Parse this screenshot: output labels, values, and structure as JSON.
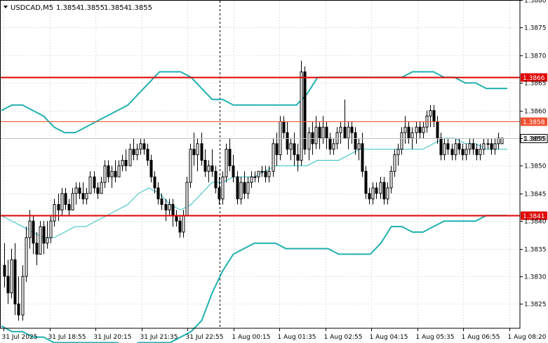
{
  "header": {
    "symbol_label": "USDCAD,M5",
    "ohlc": [
      "1.3854",
      "1.3855",
      "1.3854",
      "1.3855"
    ]
  },
  "chart_data": {
    "type": "candlestick",
    "symbol": "USDCAD",
    "timeframe": "M5",
    "ylim": [
      1.38206,
      1.388
    ],
    "y_ticks": [
      "1.3880",
      "1.3875",
      "1.3870",
      "1.3865",
      "1.3860",
      "1.3855",
      "1.3850",
      "1.3845",
      "1.3840",
      "1.3835",
      "1.3830",
      "1.3825"
    ],
    "x_ticks": [
      "31 Jul 2025",
      "31 Jul 18:55",
      "31 Jul 20:15",
      "31 Jul 21:35",
      "31 Jul 22:55",
      "1 Aug 00:15",
      "1 Aug 01:35",
      "1 Aug 02:55",
      "1 Aug 04:15",
      "1 Aug 05:35",
      "1 Aug 06:55",
      "1 Aug 08:20"
    ],
    "candles": [
      [
        1.3832,
        1.3836,
        1.3828,
        1.383
      ],
      [
        1.383,
        1.3833,
        1.3825,
        1.3827
      ],
      [
        1.3827,
        1.3835,
        1.3826,
        1.3833
      ],
      [
        1.3833,
        1.3836,
        1.3823,
        1.3825
      ],
      [
        1.3825,
        1.383,
        1.3822,
        1.3823
      ],
      [
        1.3823,
        1.3832,
        1.3822,
        1.383
      ],
      [
        1.383,
        1.3839,
        1.3829,
        1.3837
      ],
      [
        1.3837,
        1.3842,
        1.3835,
        1.384
      ],
      [
        1.384,
        1.3841,
        1.3834,
        1.3836
      ],
      [
        1.3836,
        1.3838,
        1.3832,
        1.3834
      ],
      [
        1.3834,
        1.384,
        1.3834,
        1.3839
      ],
      [
        1.3839,
        1.384,
        1.3834,
        1.3836
      ],
      [
        1.3836,
        1.384,
        1.3835,
        1.3837
      ],
      [
        1.3837,
        1.3841,
        1.3836,
        1.384
      ],
      [
        1.384,
        1.3844,
        1.3839,
        1.3843
      ],
      [
        1.3843,
        1.3845,
        1.384,
        1.3842
      ],
      [
        1.3842,
        1.3846,
        1.3841,
        1.3845
      ],
      [
        1.3845,
        1.3846,
        1.3842,
        1.3843
      ],
      [
        1.3843,
        1.3844,
        1.3841,
        1.3842
      ],
      [
        1.3842,
        1.3846,
        1.3842,
        1.3845
      ],
      [
        1.3845,
        1.3847,
        1.3843,
        1.3846
      ],
      [
        1.3846,
        1.3847,
        1.3844,
        1.3845
      ],
      [
        1.3845,
        1.3847,
        1.3843,
        1.3844
      ],
      [
        1.3844,
        1.3846,
        1.3843,
        1.3845
      ],
      [
        1.3845,
        1.3849,
        1.3845,
        1.3848
      ],
      [
        1.3848,
        1.3849,
        1.3845,
        1.3846
      ],
      [
        1.3846,
        1.3847,
        1.3844,
        1.3845
      ],
      [
        1.3845,
        1.3848,
        1.3845,
        1.3847
      ],
      [
        1.3847,
        1.3851,
        1.3846,
        1.385
      ],
      [
        1.385,
        1.3851,
        1.3847,
        1.3848
      ],
      [
        1.3848,
        1.385,
        1.3846,
        1.3849
      ],
      [
        1.3849,
        1.3851,
        1.3847,
        1.3848
      ],
      [
        1.3848,
        1.3851,
        1.3848,
        1.385
      ],
      [
        1.385,
        1.3852,
        1.3849,
        1.3851
      ],
      [
        1.3851,
        1.3853,
        1.3849,
        1.385
      ],
      [
        1.385,
        1.3854,
        1.385,
        1.3853
      ],
      [
        1.3853,
        1.3855,
        1.3851,
        1.3852
      ],
      [
        1.3852,
        1.3854,
        1.3851,
        1.3853
      ],
      [
        1.3853,
        1.3855,
        1.3852,
        1.3854
      ],
      [
        1.3854,
        1.3855,
        1.3852,
        1.3853
      ],
      [
        1.3853,
        1.3854,
        1.385,
        1.3851
      ],
      [
        1.3851,
        1.3852,
        1.3847,
        1.3848
      ],
      [
        1.3848,
        1.3849,
        1.3845,
        1.3846
      ],
      [
        1.3846,
        1.3847,
        1.3843,
        1.3844
      ],
      [
        1.3844,
        1.3845,
        1.3842,
        1.3843
      ],
      [
        1.3843,
        1.3844,
        1.384,
        1.3842
      ],
      [
        1.3842,
        1.3844,
        1.3841,
        1.3843
      ],
      [
        1.3843,
        1.3844,
        1.3839,
        1.3841
      ],
      [
        1.3841,
        1.3842,
        1.3839,
        1.384
      ],
      [
        1.384,
        1.3841,
        1.3837,
        1.3838
      ],
      [
        1.3838,
        1.3842,
        1.3837,
        1.3841
      ],
      [
        1.3841,
        1.3848,
        1.3841,
        1.3847
      ],
      [
        1.3847,
        1.3854,
        1.3846,
        1.3853
      ],
      [
        1.3853,
        1.3856,
        1.385,
        1.3852
      ],
      [
        1.3852,
        1.3855,
        1.3849,
        1.3854
      ],
      [
        1.3854,
        1.3856,
        1.385,
        1.3851
      ],
      [
        1.3851,
        1.3853,
        1.3848,
        1.3849
      ],
      [
        1.3849,
        1.3851,
        1.3847,
        1.385
      ],
      [
        1.385,
        1.3853,
        1.3848,
        1.3849
      ],
      [
        1.3849,
        1.385,
        1.3845,
        1.3846
      ],
      [
        1.3846,
        1.3848,
        1.3843,
        1.3844
      ],
      [
        1.3844,
        1.3849,
        1.3843,
        1.3848
      ],
      [
        1.3848,
        1.3854,
        1.3847,
        1.3853
      ],
      [
        1.3853,
        1.3855,
        1.3849,
        1.385
      ],
      [
        1.385,
        1.3852,
        1.3847,
        1.3848
      ],
      [
        1.3848,
        1.3849,
        1.3843,
        1.3844
      ],
      [
        1.3844,
        1.3848,
        1.3843,
        1.3847
      ],
      [
        1.3847,
        1.3849,
        1.3844,
        1.3845
      ],
      [
        1.3845,
        1.3848,
        1.3844,
        1.3847
      ],
      [
        1.3847,
        1.3849,
        1.3846,
        1.3848
      ],
      [
        1.3848,
        1.3849,
        1.3847,
        1.3848
      ],
      [
        1.3848,
        1.3849,
        1.3847,
        1.3849
      ],
      [
        1.3849,
        1.385,
        1.3848,
        1.3849
      ],
      [
        1.3849,
        1.385,
        1.3847,
        1.3848
      ],
      [
        1.3848,
        1.385,
        1.3847,
        1.3849
      ],
      [
        1.3849,
        1.3855,
        1.3848,
        1.3854
      ],
      [
        1.3854,
        1.3856,
        1.385,
        1.3852
      ],
      [
        1.3852,
        1.3859,
        1.3851,
        1.3858
      ],
      [
        1.3858,
        1.3859,
        1.3855,
        1.3856
      ],
      [
        1.3856,
        1.3858,
        1.3852,
        1.3853
      ],
      [
        1.3853,
        1.3855,
        1.3851,
        1.3854
      ],
      [
        1.3854,
        1.3856,
        1.385,
        1.3852
      ],
      [
        1.3852,
        1.3854,
        1.3849,
        1.3851
      ],
      [
        1.3851,
        1.3869,
        1.385,
        1.3867
      ],
      [
        1.3867,
        1.3868,
        1.3852,
        1.3853
      ],
      [
        1.3853,
        1.3857,
        1.3851,
        1.3856
      ],
      [
        1.3856,
        1.3858,
        1.3852,
        1.3854
      ],
      [
        1.3854,
        1.3859,
        1.3853,
        1.3857
      ],
      [
        1.3857,
        1.3858,
        1.3853,
        1.3855
      ],
      [
        1.3855,
        1.3859,
        1.3854,
        1.3857
      ],
      [
        1.3857,
        1.3858,
        1.3853,
        1.3855
      ],
      [
        1.3855,
        1.3856,
        1.3852,
        1.3853
      ],
      [
        1.3853,
        1.3855,
        1.3852,
        1.3854
      ],
      [
        1.3854,
        1.3857,
        1.3853,
        1.3856
      ],
      [
        1.3856,
        1.3858,
        1.3854,
        1.3857
      ],
      [
        1.3857,
        1.3862,
        1.3856,
        1.3855
      ],
      [
        1.3855,
        1.3858,
        1.3853,
        1.3857
      ],
      [
        1.3857,
        1.3858,
        1.3854,
        1.3856
      ],
      [
        1.3856,
        1.3857,
        1.3852,
        1.3853
      ],
      [
        1.3853,
        1.3855,
        1.3851,
        1.3854
      ],
      [
        1.3854,
        1.3856,
        1.3848,
        1.3849
      ],
      [
        1.3849,
        1.385,
        1.3844,
        1.3845
      ],
      [
        1.3845,
        1.3846,
        1.3843,
        1.3844
      ],
      [
        1.3844,
        1.3847,
        1.3843,
        1.3846
      ],
      [
        1.3846,
        1.3847,
        1.3844,
        1.3845
      ],
      [
        1.3845,
        1.3848,
        1.3844,
        1.3847
      ],
      [
        1.3847,
        1.3848,
        1.3843,
        1.3844
      ],
      [
        1.3844,
        1.3847,
        1.3843,
        1.3846
      ],
      [
        1.3846,
        1.385,
        1.3845,
        1.3849
      ],
      [
        1.3849,
        1.3853,
        1.3848,
        1.3852
      ],
      [
        1.3852,
        1.3854,
        1.385,
        1.3853
      ],
      [
        1.3853,
        1.3857,
        1.3852,
        1.3856
      ],
      [
        1.3856,
        1.3859,
        1.3854,
        1.3857
      ],
      [
        1.3857,
        1.3858,
        1.3854,
        1.3855
      ],
      [
        1.3855,
        1.3857,
        1.3853,
        1.3856
      ],
      [
        1.3856,
        1.3858,
        1.3854,
        1.3857
      ],
      [
        1.3857,
        1.3858,
        1.3855,
        1.3856
      ],
      [
        1.3856,
        1.3858,
        1.3855,
        1.3857
      ],
      [
        1.3857,
        1.386,
        1.3856,
        1.3859
      ],
      [
        1.3859,
        1.3861,
        1.3857,
        1.386
      ],
      [
        1.386,
        1.3861,
        1.3857,
        1.3858
      ],
      [
        1.3858,
        1.3859,
        1.3854,
        1.3855
      ],
      [
        1.3855,
        1.3856,
        1.3851,
        1.3852
      ],
      [
        1.3852,
        1.3855,
        1.3851,
        1.3854
      ],
      [
        1.3854,
        1.3855,
        1.3852,
        1.3853
      ],
      [
        1.3853,
        1.3854,
        1.3851,
        1.3852
      ],
      [
        1.3852,
        1.3855,
        1.3851,
        1.3854
      ],
      [
        1.3854,
        1.3855,
        1.3852,
        1.3853
      ],
      [
        1.3853,
        1.3854,
        1.3851,
        1.3852
      ],
      [
        1.3852,
        1.3854,
        1.3851,
        1.3853
      ],
      [
        1.3853,
        1.3855,
        1.3852,
        1.3854
      ],
      [
        1.3854,
        1.3855,
        1.3852,
        1.3853
      ],
      [
        1.3853,
        1.3854,
        1.3851,
        1.3852
      ],
      [
        1.3852,
        1.3854,
        1.3851,
        1.3853
      ],
      [
        1.3853,
        1.3855,
        1.3852,
        1.3854
      ],
      [
        1.3854,
        1.3855,
        1.3853,
        1.3854
      ],
      [
        1.3854,
        1.3855,
        1.3852,
        1.3853
      ],
      [
        1.3853,
        1.3855,
        1.3852,
        1.3854
      ],
      [
        1.3854,
        1.3856,
        1.3853,
        1.3855
      ],
      [
        1.3854,
        1.3855,
        1.3854,
        1.3855
      ]
    ],
    "bollinger_upper": [
      1.386,
      1.3861,
      1.3861,
      1.386,
      1.3859,
      1.3857,
      1.3856,
      1.3856,
      1.3857,
      1.3858,
      1.3859,
      1.386,
      1.3861,
      1.3863,
      1.3865,
      1.3867,
      1.3867,
      1.3867,
      1.3866,
      1.3864,
      1.3862,
      1.3862,
      1.3861,
      1.3861,
      1.3861,
      1.3861,
      1.3861,
      1.3861,
      1.3861,
      1.3863,
      1.3866,
      1.3866,
      1.3866,
      1.3866,
      1.3866,
      1.3866,
      1.3866,
      1.3866,
      1.3866,
      1.3867,
      1.3867,
      1.3867,
      1.3866,
      1.3866,
      1.3865,
      1.3865,
      1.3864,
      1.3864,
      1.3864
    ],
    "bollinger_middle": [
      1.3841,
      1.384,
      1.3839,
      1.3838,
      1.3837,
      1.3837,
      1.3838,
      1.3839,
      1.3839,
      1.384,
      1.3841,
      1.3842,
      1.3843,
      1.3845,
      1.3846,
      1.3845,
      1.3843,
      1.3842,
      1.3843,
      1.3845,
      1.3847,
      1.3847,
      1.3848,
      1.3848,
      1.3848,
      1.3849,
      1.385,
      1.385,
      1.385,
      1.385,
      1.3851,
      1.3851,
      1.3851,
      1.3852,
      1.3853,
      1.3853,
      1.3853,
      1.3853,
      1.3853,
      1.3853,
      1.3853,
      1.3854,
      1.3855,
      1.3855,
      1.3854,
      1.3854,
      1.3853,
      1.3853,
      1.3853
    ],
    "bollinger_lower": [
      1.3821,
      1.382,
      1.382,
      1.3819,
      1.3819,
      1.3818,
      1.3818,
      1.3818,
      1.3818,
      1.3818,
      1.3818,
      1.3818,
      1.3817,
      1.3818,
      1.3818,
      1.3818,
      1.3818,
      1.3819,
      1.382,
      1.3822,
      1.3827,
      1.3831,
      1.3834,
      1.3835,
      1.3836,
      1.3836,
      1.3836,
      1.3835,
      1.3835,
      1.3835,
      1.3835,
      1.3835,
      1.3834,
      1.3834,
      1.3834,
      1.3834,
      1.3836,
      1.3839,
      1.3839,
      1.3838,
      1.3838,
      1.3839,
      1.384,
      1.384,
      1.384,
      1.384,
      1.3841,
      1.3841,
      1.3841
    ],
    "levels": [
      {
        "label": "1.3866",
        "value": 1.3866,
        "color": "#e00000",
        "style": "bold"
      },
      {
        "label": "1.3858",
        "value": 1.3858,
        "color": "#f05030",
        "style": "thin"
      },
      {
        "label": "1.3841",
        "value": 1.3841,
        "color": "#e00000",
        "style": "bold"
      }
    ],
    "current_price": {
      "label": "1.3855",
      "value": 1.3855
    },
    "vertical_marker_index": 44,
    "colors": {
      "candle": "#000000",
      "bands": "#20b0b0",
      "middle": "#30c0c0",
      "grid": "#c8c8c8"
    },
    "grid": true
  }
}
